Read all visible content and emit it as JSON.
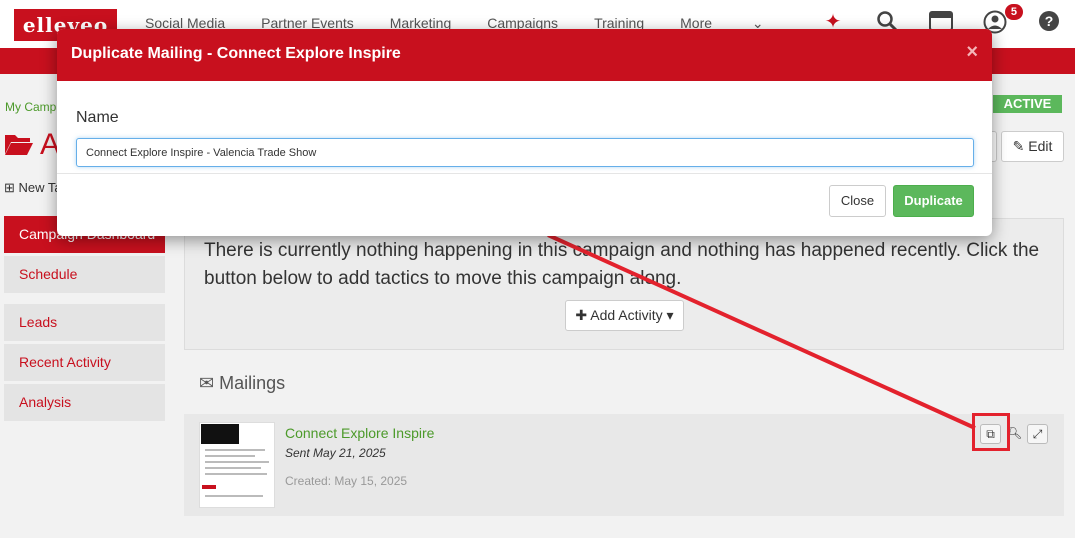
{
  "header": {
    "logo": "elleveo",
    "nav": [
      "Social Media",
      "Partner Events",
      "Marketing",
      "Campaigns",
      "Training",
      "More"
    ],
    "notification_count": "5"
  },
  "breadcrumb": "My Campa",
  "status": "ACTIVE",
  "page_title_fragment": "A",
  "edit_label": "Edit",
  "new_tactic_label": "New Ta",
  "sidebar": {
    "items": [
      {
        "label": "Campaign Dashboard"
      },
      {
        "label": "Schedule"
      },
      {
        "label": "Leads"
      },
      {
        "label": "Recent Activity"
      },
      {
        "label": "Analysis"
      }
    ]
  },
  "panel": {
    "message": "There is currently nothing happening in this campaign and nothing has happened recently. Click the button below to add tactics to move this campaign along.",
    "add_activity": "Add Activity"
  },
  "mailings": {
    "heading": "Mailings",
    "item": {
      "title": "Connect Explore Inspire",
      "sent": "Sent May 21, 2025",
      "created": "Created: May 15, 2025"
    }
  },
  "modal": {
    "title": "Duplicate Mailing - Connect Explore Inspire",
    "close_x": "×",
    "field_label": "Name",
    "field_value": "Connect Explore Inspire - Valencia Trade Show",
    "close_button": "Close",
    "duplicate_button": "Duplicate"
  },
  "colors": {
    "brand_red": "#c8101e",
    "success_green": "#5cb85c",
    "link_green": "#4c9a2a",
    "annotation_red": "#e3222d"
  }
}
